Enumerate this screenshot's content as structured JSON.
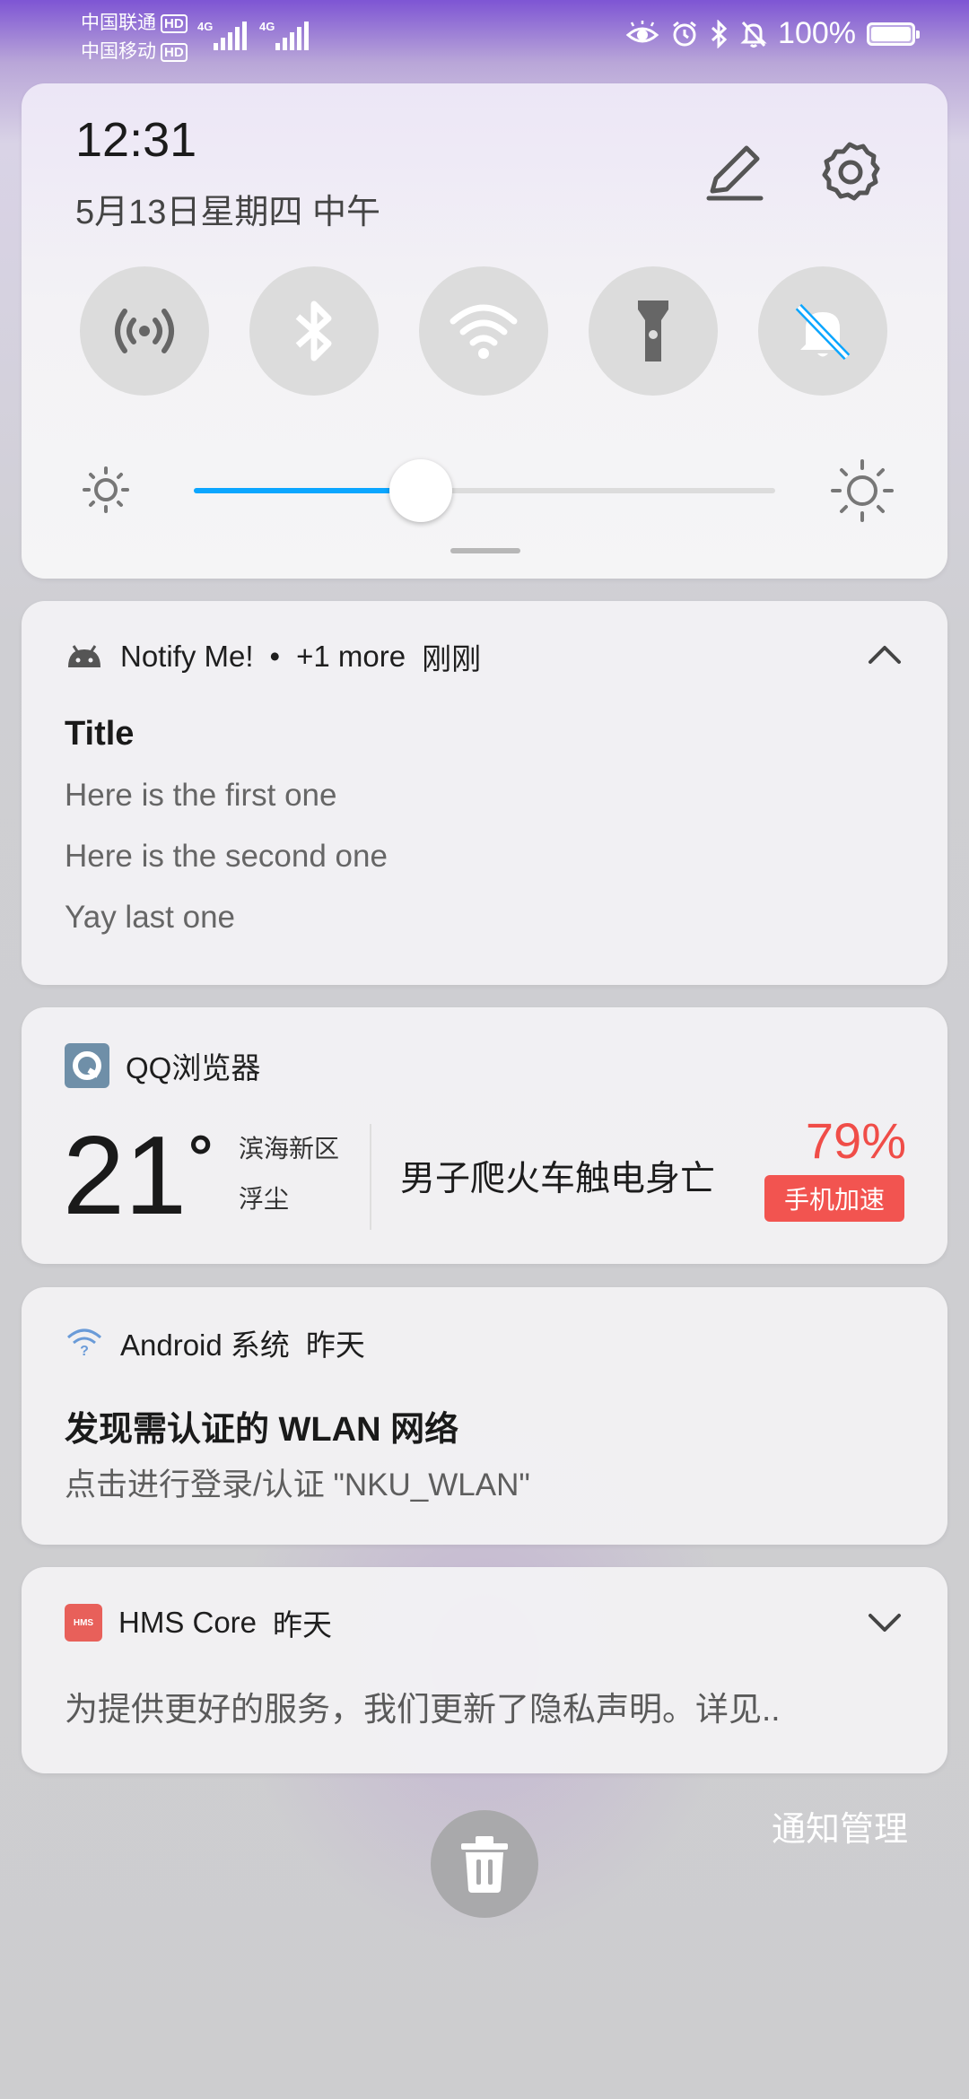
{
  "status_bar": {
    "carrier1": "中国联通",
    "carrier2": "中国移动",
    "hd_label": "HD",
    "network_label": "4G",
    "battery_text": "100%",
    "battery_level": 1.0,
    "icons": [
      "eye-icon",
      "alarm-icon",
      "bluetooth-icon",
      "bell-off-icon",
      "battery-icon"
    ]
  },
  "quick_settings": {
    "time": "12:31",
    "date": "5月13日星期四 中午",
    "toggles": [
      {
        "name": "hotspot",
        "on": false
      },
      {
        "name": "bluetooth",
        "on": true
      },
      {
        "name": "wifi",
        "on": true
      },
      {
        "name": "flashlight",
        "on": false
      },
      {
        "name": "mute",
        "on": true
      }
    ],
    "brightness_level": 0.39
  },
  "notifications": {
    "notify_me": {
      "app": "Notify Me!",
      "separator": "•",
      "more": "+1 more",
      "time": "刚刚",
      "title": "Title",
      "lines": [
        "Here is the first one",
        "Here is the second one",
        "Yay last one"
      ]
    },
    "qq_browser": {
      "app": "QQ浏览器",
      "temperature": "21",
      "degree": "°",
      "location": "滨海新区",
      "air": "浮尘",
      "headline": "男子爬火车触电身亡",
      "percent": "79%",
      "boost_label": "手机加速"
    },
    "android_system": {
      "app": "Android 系统",
      "time": "昨天",
      "title": "发现需认证的 WLAN 网络",
      "text": "点击进行登录/认证 \"NKU_WLAN\""
    },
    "hms_core": {
      "app": "HMS Core",
      "time": "昨天",
      "icon_label": "HMS",
      "text": "为提供更好的服务，我们更新了隐私声明。详见.."
    }
  },
  "footer": {
    "manage_label": "通知管理"
  },
  "colors": {
    "accent": "#0ba6ff",
    "red": "#f04d48"
  }
}
